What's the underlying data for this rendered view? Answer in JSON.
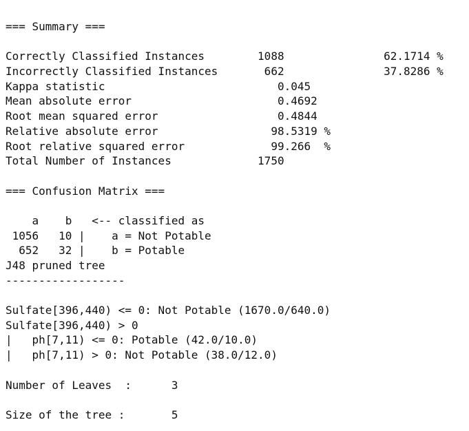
{
  "lines": [
    "=== Summary ===",
    "",
    "Correctly Classified Instances        1088               62.1714 %",
    "Incorrectly Classified Instances       662               37.8286 %",
    "Kappa statistic                          0.045",
    "Mean absolute error                      0.4692",
    "Root mean squared error                  0.4844",
    "Relative absolute error                 98.5319 %",
    "Root relative squared error             99.266  %",
    "Total Number of Instances             1750",
    "",
    "=== Confusion Matrix ===",
    "",
    "    a    b   <-- classified as",
    " 1056   10 |    a = Not Potable",
    "  652   32 |    b = Potable",
    "J48 pruned tree",
    "------------------",
    "",
    "Sulfate[396,440) <= 0: Not Potable (1670.0/640.0)",
    "Sulfate[396,440) > 0",
    "|   ph[7,11) <= 0: Potable (42.0/10.0)",
    "|   ph[7,11) > 0: Not Potable (38.0/12.0)",
    "",
    "Number of Leaves  :      3",
    "",
    "Size of the tree :       5"
  ]
}
